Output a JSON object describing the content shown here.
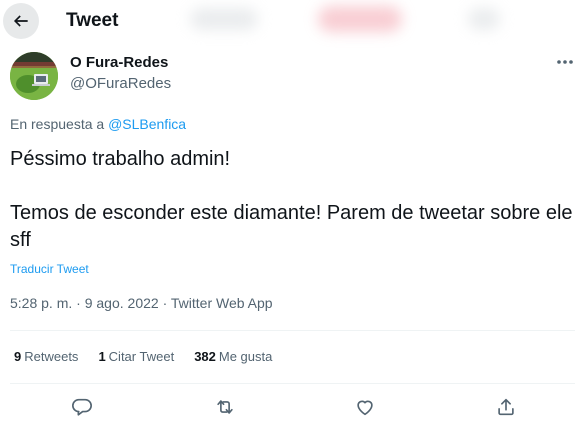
{
  "header": {
    "title": "Tweet"
  },
  "author": {
    "name": "O Fura-Redes",
    "handle": "@OFuraRedes"
  },
  "reply": {
    "prefix": "En respuesta a ",
    "mention": "@SLBenfica"
  },
  "tweet": {
    "line1": "Péssimo trabalho admin!",
    "line2": "Temos de esconder este diamante! Parem de tweetar sobre ele sff"
  },
  "translate_label": "Traducir Tweet",
  "meta": {
    "time": "5:28 p. m.",
    "separator1": " · ",
    "date": "9 ago. 2022",
    "separator2": " · ",
    "source": "Twitter Web App"
  },
  "stats": {
    "retweets_count": "9",
    "retweets_label": "Retweets",
    "quotes_count": "1",
    "quotes_label": "Citar Tweet",
    "likes_count": "382",
    "likes_label": "Me gusta"
  },
  "icons": {
    "back": "arrow-left-icon",
    "more": "more-horizontal-icon",
    "reply": "reply-icon",
    "retweet": "retweet-icon",
    "like": "heart-icon",
    "share": "share-icon"
  },
  "colors": {
    "accent": "#1d9bf0",
    "text": "#0f1419",
    "secondary": "#536471",
    "divider": "#eff3f4"
  }
}
